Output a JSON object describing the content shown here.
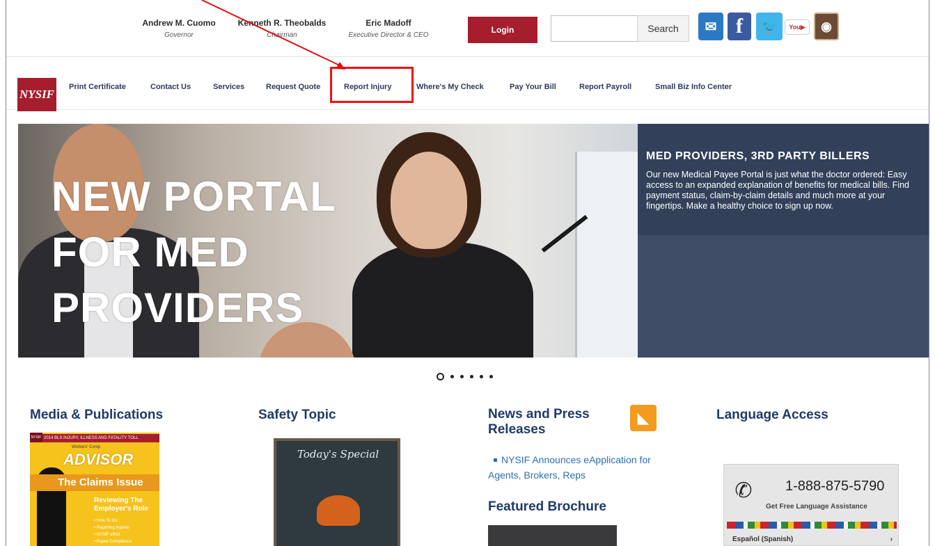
{
  "officials": [
    {
      "name": "Andrew M. Cuomo",
      "role": "Governor"
    },
    {
      "name": "Kenneth R. Theobalds",
      "role": "Chairman"
    },
    {
      "name": "Eric Madoff",
      "role": "Executive Director & CEO"
    }
  ],
  "header": {
    "login_label": "Login",
    "search_placeholder": "",
    "search_label": "Search",
    "social_icons": [
      "mail-subscribe-icon",
      "facebook-icon",
      "twitter-icon",
      "youtube-icon",
      "instagram-icon"
    ]
  },
  "nav": {
    "logo": "NYSIF",
    "items": [
      "Print Certificate",
      "Contact Us",
      "Services",
      "Request Quote",
      "Report Injury",
      "Where's My Check",
      "Pay Your Bill",
      "Report Payroll",
      "Small Biz Info Center"
    ],
    "highlighted": "Report Injury"
  },
  "hero": {
    "title_lines": [
      "NEW PORTAL",
      "FOR MED",
      "PROVIDERS"
    ],
    "panel_title": "MED PROVIDERS, 3RD PARTY BILLERS",
    "panel_text": "Our new Medical Payee Portal is just what the doctor ordered: Easy access to an expanded explanation of benefits for medical bills. Find payment status, claim-by-claim details and much more at your fingertips. Make a healthy choice to sign up now.",
    "slides": 6,
    "active_slide": 1
  },
  "media": {
    "heading": "Media & Publications",
    "cover": {
      "banner": "2014 BLS INJURY, ILLNESS AND FATALITY TOLL",
      "brand": "NYSIF",
      "subtitle": "Workers' Comp",
      "title": "ADVISOR",
      "issue": "The Claims Issue",
      "role_lines": [
        "Reviewing The",
        "Employer's Role"
      ],
      "list": [
        "• How To Do:",
        "• Reporting Injuries",
        "• NYSIF eROI",
        "• Payee Compliance"
      ]
    }
  },
  "safety": {
    "heading": "Safety Topic",
    "board_text": "Today's Special"
  },
  "news": {
    "heading": "News and Press Releases",
    "link": "NYSIF Announces eApplication for Agents, Brokers, Reps",
    "featured_heading": "Featured Brochure"
  },
  "language": {
    "heading": "Language Access",
    "phone": "1-888-875-5790",
    "phone_sub": "Get Free Language Assistance",
    "selected": "Español (Spanish)"
  },
  "colors": {
    "brand_red": "#a61e2e",
    "nav_text": "#2f3a58",
    "heading_blue": "#1f3a68",
    "hero_panel": "#3f4d66",
    "highlight_red": "#ee1111"
  }
}
